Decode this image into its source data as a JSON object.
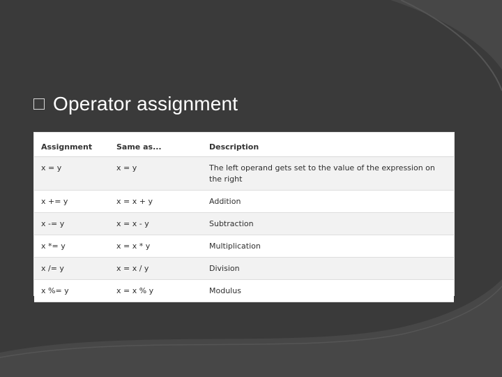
{
  "slide": {
    "title": "Operator assignment",
    "bullet_icon": "hollow-square-bullet"
  },
  "table": {
    "headers": [
      "Assignment",
      "Same as...",
      "Description"
    ],
    "rows": [
      [
        "x = y",
        "x = y",
        "The left operand gets set to the value of the expression on the right"
      ],
      [
        "x += y",
        "x = x + y",
        "Addition"
      ],
      [
        "x -= y",
        "x = x - y",
        "Subtraction"
      ],
      [
        "x *= y",
        "x = x * y",
        "Multiplication"
      ],
      [
        "x /= y",
        "x = x / y",
        "Division"
      ],
      [
        "x %= y",
        "x = x % y",
        "Modulus"
      ]
    ]
  },
  "colors": {
    "background": "#3a3a3a",
    "swoosh": "#4a4a4a",
    "title": "#ffffff",
    "table_bg": "#ffffff",
    "row_stripe": "#f2f2f2"
  }
}
